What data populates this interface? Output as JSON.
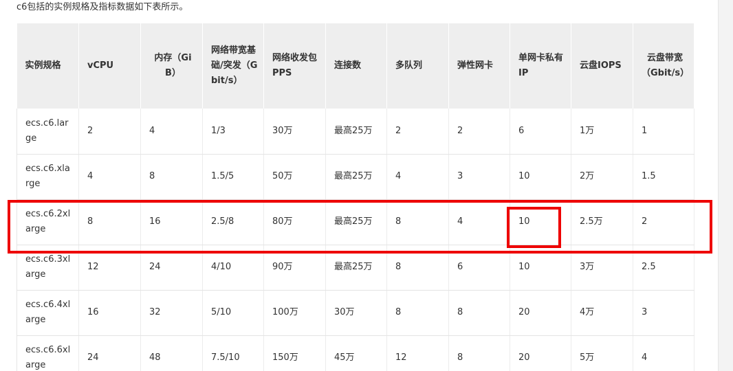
{
  "intro_text": "c6包括的实例规格及指标数据如下表所示。",
  "table": {
    "headers": [
      "实例规格",
      "vCPU",
      "内存（GiB）",
      "网络带宽基础/突发（Gbit/s）",
      "网络收发包PPS",
      "连接数",
      "多队列",
      "弹性网卡",
      "单网卡私有IP",
      "云盘IOPS",
      "云盘带宽（Gbit/s）"
    ],
    "rows": [
      [
        "ecs.c6.large",
        "2",
        "4",
        "1/3",
        "30万",
        "最高25万",
        "2",
        "2",
        "6",
        "1万",
        "1"
      ],
      [
        "ecs.c6.xlarge",
        "4",
        "8",
        "1.5/5",
        "50万",
        "最高25万",
        "4",
        "3",
        "10",
        "2万",
        "1.5"
      ],
      [
        "ecs.c6.2xlarge",
        "8",
        "16",
        "2.5/8",
        "80万",
        "最高25万",
        "8",
        "4",
        "10",
        "2.5万",
        "2"
      ],
      [
        "ecs.c6.3xlarge",
        "12",
        "24",
        "4/10",
        "90万",
        "最高25万",
        "8",
        "6",
        "10",
        "3万",
        "2.5"
      ],
      [
        "ecs.c6.4xlarge",
        "16",
        "32",
        "5/10",
        "100万",
        "30万",
        "8",
        "8",
        "20",
        "4万",
        "3"
      ],
      [
        "ecs.c6.6xlarge",
        "24",
        "48",
        "7.5/10",
        "150万",
        "45万",
        "12",
        "8",
        "20",
        "5万",
        "4"
      ]
    ]
  },
  "annotations": {
    "highlight_color": "#ee0000",
    "highlighted_row_index": 2,
    "highlighted_cell": "单网卡私有IP"
  }
}
